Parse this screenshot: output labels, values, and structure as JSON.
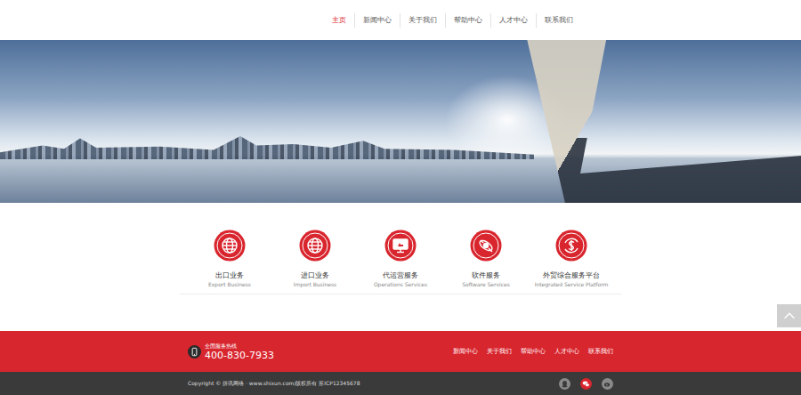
{
  "nav": {
    "items": [
      {
        "label": "主页",
        "selected": true
      },
      {
        "label": "新闻中心",
        "selected": false
      },
      {
        "label": "关于我们",
        "selected": false
      },
      {
        "label": "帮助中心",
        "selected": false
      },
      {
        "label": "人才中心",
        "selected": false
      },
      {
        "label": "联系我们",
        "selected": false
      }
    ]
  },
  "services": [
    {
      "title": "出口业务",
      "subtitle": "Export Business"
    },
    {
      "title": "进口业务",
      "subtitle": "Import Business"
    },
    {
      "title": "代运营服务",
      "subtitle": "Operations Services"
    },
    {
      "title": "软件服务",
      "subtitle": "Software Services"
    },
    {
      "title": "外贸综合服务平台",
      "subtitle": "Integrated Service Platform"
    }
  ],
  "footer": {
    "hotline_label": "全国服务热线",
    "hotline": "400-830-7933",
    "links": [
      "新闻中心",
      "关于我们",
      "帮助中心",
      "人才中心",
      "联系我们"
    ]
  },
  "copyright": "Copyright © 拼讯网络 · www.shixun.com/版权所有 苏ICP12345678"
}
